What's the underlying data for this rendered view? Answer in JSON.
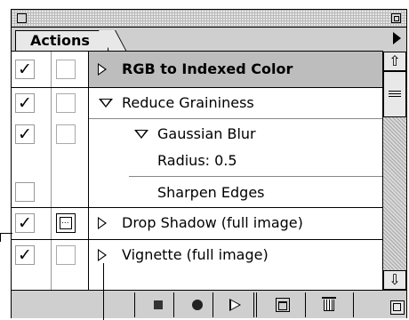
{
  "panel": {
    "tab_label": "Actions"
  },
  "actions": [
    {
      "label": "RGB to Indexed Color",
      "type": "action",
      "expanded": false,
      "checked": true,
      "dialog": false,
      "highlighted": true
    },
    {
      "label": "Reduce Graininess",
      "type": "action",
      "expanded": true,
      "checked": true,
      "dialog": false
    },
    {
      "label": "Gaussian Blur",
      "type": "step",
      "expanded": true,
      "checked": true,
      "dialog": false
    },
    {
      "label": "Radius: 0.5",
      "type": "parameter"
    },
    {
      "label": "Sharpen Edges",
      "type": "step",
      "checked": false,
      "dialog": false
    },
    {
      "label": "Drop Shadow (full image)",
      "type": "action",
      "expanded": false,
      "checked": true,
      "dialog": true
    },
    {
      "label": "Vignette (full image)",
      "type": "action",
      "expanded": false,
      "checked": true,
      "dialog": false
    }
  ],
  "checkmark": "✓",
  "scrollbar": {
    "up_arrow": "⇧",
    "down_arrow": "⇩"
  },
  "toolbar": [
    "stop-icon",
    "record-icon",
    "play-icon",
    "new-set-icon",
    "trash-icon"
  ]
}
